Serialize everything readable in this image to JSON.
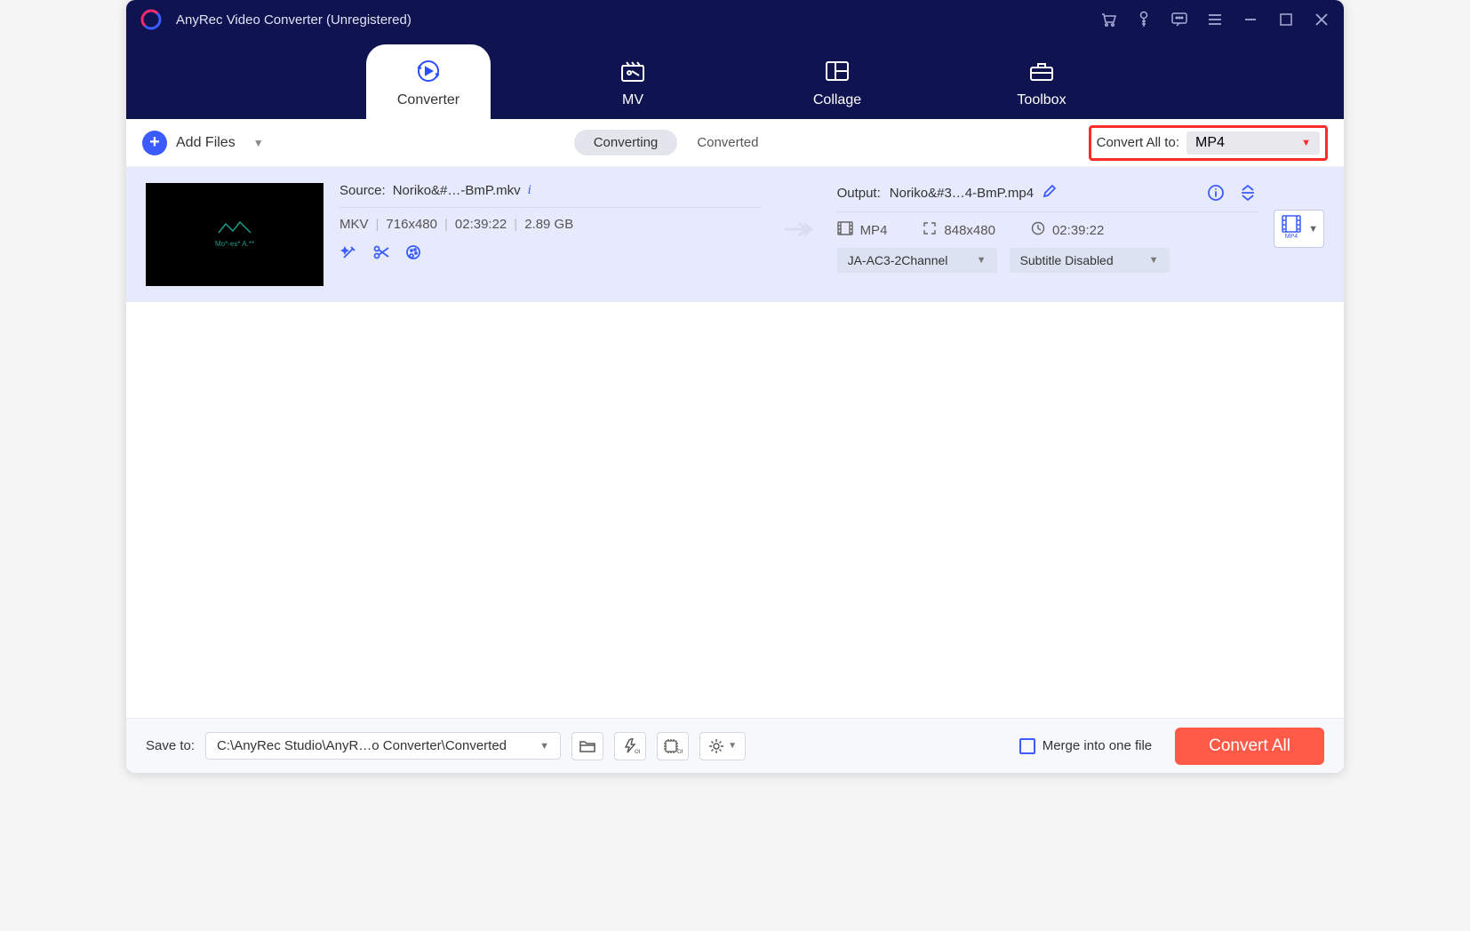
{
  "titlebar": {
    "title": "AnyRec Video Converter (Unregistered)"
  },
  "nav": {
    "items": [
      {
        "label": "Converter"
      },
      {
        "label": "MV"
      },
      {
        "label": "Collage"
      },
      {
        "label": "Toolbox"
      }
    ]
  },
  "toolbar": {
    "add_label": "Add Files",
    "subtabs": {
      "converting": "Converting",
      "converted": "Converted"
    },
    "convert_all_label": "Convert All to:",
    "convert_all_value": "MP4"
  },
  "item": {
    "source_prefix": "Source: ",
    "source_name": "Noriko&#…-BmP.mkv",
    "src_fmt": "MKV",
    "src_res": "716x480",
    "src_dur": "02:39:22",
    "src_size": "2.89 GB",
    "output_prefix": "Output: ",
    "output_name": "Noriko&#3…4-BmP.mp4",
    "out_fmt": "MP4",
    "out_res": "848x480",
    "out_dur": "02:39:22",
    "audio_dd": "JA-AC3-2Channel",
    "subtitle_dd": "Subtitle Disabled",
    "fmt_badge": "MP4"
  },
  "footer": {
    "save_label": "Save to:",
    "save_path": "C:\\AnyRec Studio\\AnyR…o Converter\\Converted",
    "merge_label": "Merge into one file",
    "convert_btn": "Convert All"
  }
}
